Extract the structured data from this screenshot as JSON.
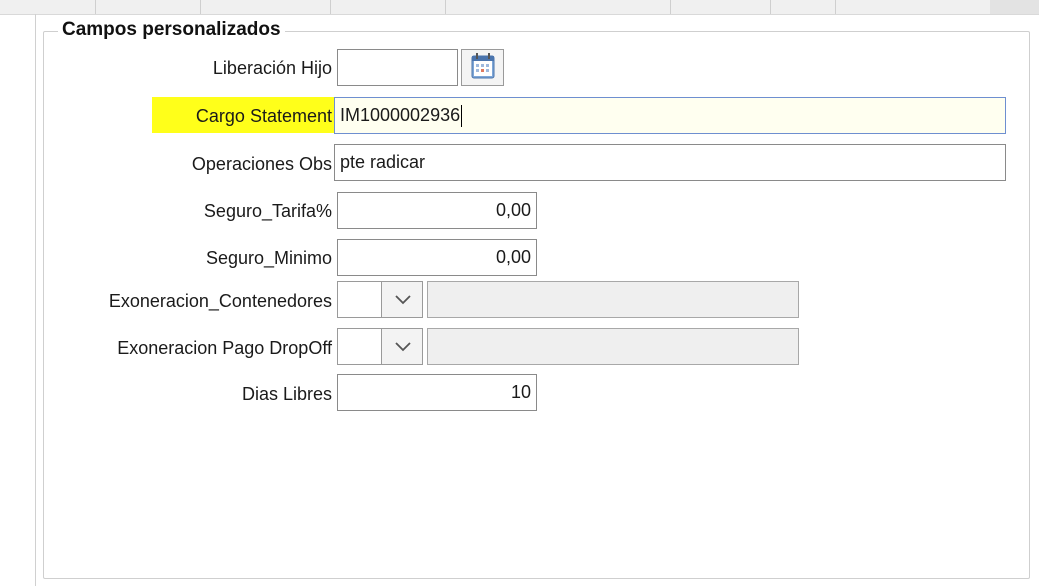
{
  "group_title": "Campos personalizados",
  "fields": {
    "liberacion_hijo": {
      "label": "Liberación Hijo",
      "value": ""
    },
    "cargo_statement": {
      "label": "Cargo Statement",
      "value": "IM1000002936"
    },
    "operaciones_obs": {
      "label": "Operaciones Obs",
      "value": "pte radicar"
    },
    "seguro_tarifa": {
      "label": "Seguro_Tarifa%",
      "value": "0,00"
    },
    "seguro_minimo": {
      "label": "Seguro_Minimo",
      "value": "0,00"
    },
    "exoneracion_contenedores": {
      "label": "Exoneracion_Contenedores",
      "code": "",
      "description": ""
    },
    "exoneracion_pago_dropoff": {
      "label": "Exoneracion Pago DropOff",
      "code": "",
      "description": ""
    },
    "dias_libres": {
      "label": "Dias Libres",
      "value": "10"
    }
  },
  "icons": {
    "calendar": "calendar-icon",
    "dropdown": "chevron-down-icon"
  },
  "colors": {
    "highlight": "#ffff1a",
    "focused_border": "#6e8fd0",
    "focused_background": "#fffff0"
  }
}
